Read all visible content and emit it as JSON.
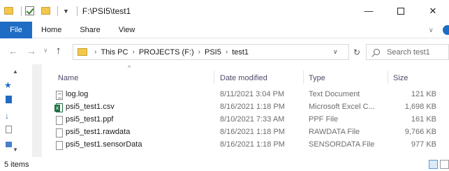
{
  "window": {
    "title": "F:\\PSI5\\test1"
  },
  "ribbon": {
    "file": "File",
    "tabs": [
      "Home",
      "Share",
      "View"
    ]
  },
  "address": {
    "crumbs": [
      "This PC",
      "PROJECTS (F:)",
      "PSI5",
      "test1"
    ],
    "search_placeholder": "Search test1"
  },
  "columns": {
    "name": "Name",
    "date": "Date modified",
    "type": "Type",
    "size": "Size"
  },
  "files": [
    {
      "name": "log.log",
      "date": "8/11/2021 3:04 PM",
      "type": "Text Document",
      "size": "121 KB",
      "icon": "text-file-icon"
    },
    {
      "name": "psi5_test1.csv",
      "date": "8/16/2021 1:18 PM",
      "type": "Microsoft Excel C...",
      "size": "1,698 KB",
      "icon": "excel-file-icon"
    },
    {
      "name": "psi5_test1.ppf",
      "date": "8/10/2021 7:33 AM",
      "type": "PPF File",
      "size": "161 KB",
      "icon": "blank-file-icon"
    },
    {
      "name": "psi5_test1.rawdata",
      "date": "8/16/2021 1:18 PM",
      "type": "RAWDATA File",
      "size": "9,766 KB",
      "icon": "blank-file-icon"
    },
    {
      "name": "psi5_test1.sensorData",
      "date": "8/16/2021 1:18 PM",
      "type": "SENSORDATA File",
      "size": "977 KB",
      "icon": "blank-file-icon"
    }
  ],
  "status": {
    "items": "5 items"
  }
}
